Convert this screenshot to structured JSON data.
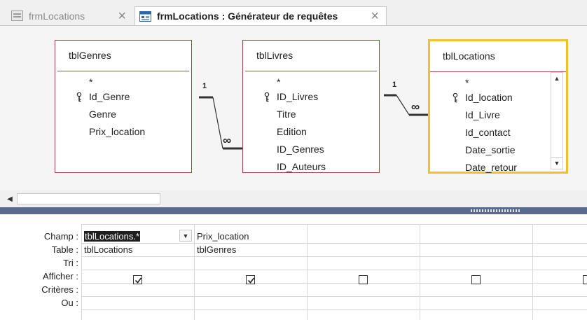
{
  "tabs": [
    {
      "label": "frmLocations",
      "active": false
    },
    {
      "label": "frmLocations : Générateur de requêtes",
      "active": true
    }
  ],
  "tables": [
    {
      "name": "tblGenres",
      "fields": [
        "*",
        "Id_Genre",
        "Genre",
        "Prix_location"
      ],
      "key_field": "Id_Genre"
    },
    {
      "name": "tblLivres",
      "fields": [
        "*",
        "ID_Livres",
        "Titre",
        "Edition",
        "ID_Genres",
        "ID_Auteurs"
      ],
      "key_field": "ID_Livres"
    },
    {
      "name": "tblLocations",
      "fields": [
        "*",
        "Id_location",
        "Id_Livre",
        "Id_contact",
        "Date_sortie",
        "Date_retour"
      ],
      "key_field": "Id_location",
      "selected": true
    }
  ],
  "relations": [
    {
      "one": "1",
      "many": "∞"
    },
    {
      "one": "1",
      "many": "∞"
    }
  ],
  "grid": {
    "row_labels": [
      "Champ :",
      "Table :",
      "Tri :",
      "Afficher :",
      "Critères :",
      "Ou :"
    ],
    "columns": [
      {
        "champ": "tblLocations.*",
        "table": "tblLocations",
        "afficher": true
      },
      {
        "champ": "Prix_location",
        "table": "tblGenres",
        "afficher": true
      },
      {
        "champ": "",
        "table": "",
        "afficher": false
      },
      {
        "champ": "",
        "table": "",
        "afficher": false
      },
      {
        "champ": "",
        "table": "",
        "afficher": false
      }
    ]
  },
  "colors": {
    "selected_table_border": "#f2c02c",
    "table_border": "#a94444",
    "splitter": "#5a6a8a"
  }
}
